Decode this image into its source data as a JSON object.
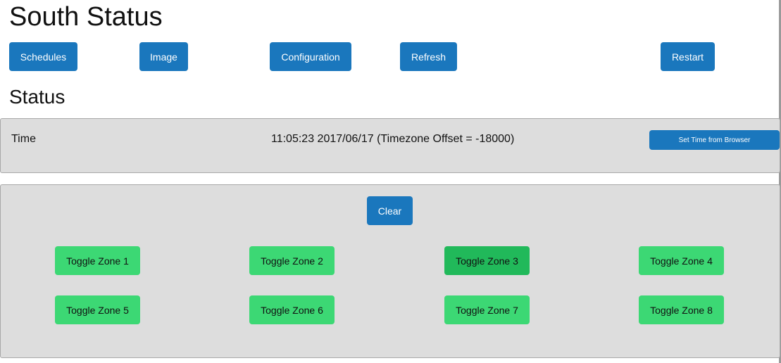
{
  "header": {
    "title": "South Status"
  },
  "nav": {
    "schedules": "Schedules",
    "image": "Image",
    "configuration": "Configuration",
    "refresh": "Refresh",
    "restart": "Restart"
  },
  "status": {
    "heading": "Status",
    "time_label": "Time",
    "time_value": "11:05:23 2017/06/17 (Timezone Offset = -18000)",
    "set_time_button": "Set Time from Browser"
  },
  "zones": {
    "clear_button": "Clear",
    "buttons": [
      "Toggle Zone 1",
      "Toggle Zone 2",
      "Toggle Zone 3",
      "Toggle Zone 4",
      "Toggle Zone 5",
      "Toggle Zone 6",
      "Toggle Zone 7",
      "Toggle Zone 8"
    ],
    "active_zone": 3
  },
  "colors": {
    "button_blue": "#1a77bd",
    "zone_green": "#3cd874",
    "zone_active_green": "#21b95a",
    "panel_bg": "#dddddd"
  }
}
